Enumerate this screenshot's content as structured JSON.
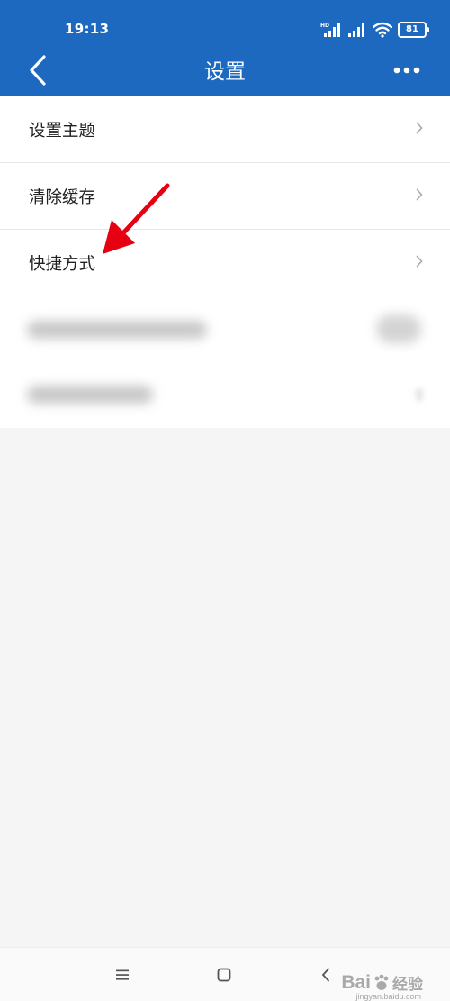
{
  "status_bar": {
    "time": "19:13",
    "network_badge": "HD",
    "battery": "81"
  },
  "header": {
    "title": "设置",
    "back_icon": "chevron-left-icon",
    "more_icon": "more-horizontal-icon"
  },
  "settings": {
    "items": [
      {
        "label": "设置主题",
        "icon": "chevron-right-icon"
      },
      {
        "label": "清除缓存",
        "icon": "chevron-right-icon"
      },
      {
        "label": "快捷方式",
        "icon": "chevron-right-icon"
      }
    ]
  },
  "nav_bar": {
    "menu_icon": "menu-icon",
    "home_icon": "home-square-icon",
    "back_icon": "back-chevron-icon"
  },
  "watermark": {
    "brand": "Bai",
    "brand_suffix": "经验",
    "url": "jingyan.baidu.com"
  },
  "colors": {
    "app_bar": "#1d69bf",
    "background": "#f5f5f5",
    "annotation_arrow": "#e60012"
  }
}
